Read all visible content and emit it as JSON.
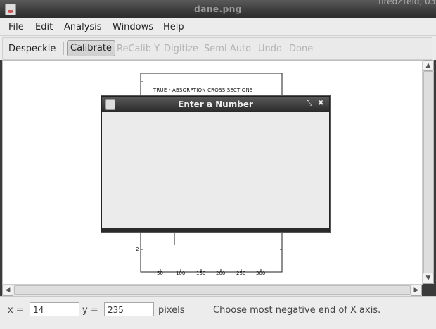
{
  "window": {
    "title": "dane.png",
    "clipped_text": "firedZteld, 03"
  },
  "menu": [
    "File",
    "Edit",
    "Analysis",
    "Windows",
    "Help"
  ],
  "toolbar": {
    "despeckle": "Despeckle",
    "calibrate": "Calibrate",
    "recalib_y": "ReCalib Y",
    "digitize": "Digitize",
    "semi_auto": "Semi-Auto",
    "undo": "Undo",
    "done": "Done"
  },
  "plot": {
    "title": "TRUE - ABSORPTION CROSS SECTIONS",
    "y_tick": "2",
    "x_ticks": [
      "50",
      "100",
      "150",
      "200",
      "250",
      "300"
    ]
  },
  "dialog": {
    "title": "Enter a Number"
  },
  "status": {
    "x_label": "x =",
    "x_value": "14",
    "y_label": "y =",
    "y_value": "235",
    "units": "pixels",
    "message": "Choose most negative end of X axis."
  }
}
